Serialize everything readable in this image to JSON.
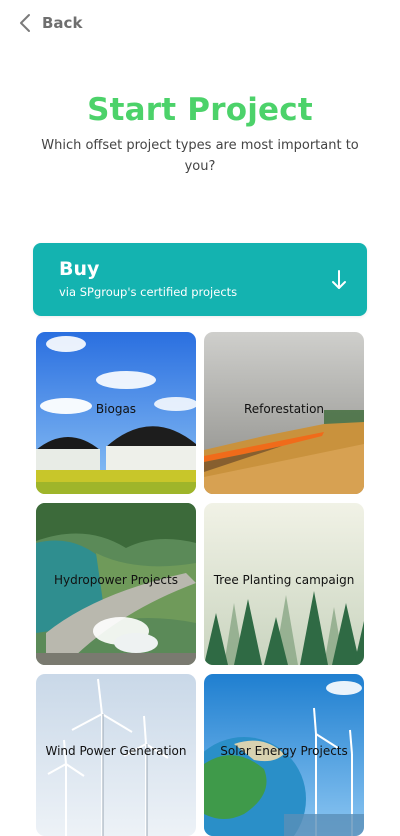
{
  "header": {
    "back_label": "Back"
  },
  "intro": {
    "title": "Start Project",
    "subtitle": "Which offset project types are most important to you?"
  },
  "buy": {
    "label": "Buy",
    "sub": "via SPgroup's certified projects"
  },
  "projects": [
    {
      "label": "Biogas"
    },
    {
      "label": "Reforestation"
    },
    {
      "label": "Hydropower Projects"
    },
    {
      "label": "Tree Planting campaign"
    },
    {
      "label": "Wind Power Generation"
    },
    {
      "label": "Solar Energy Projects"
    }
  ],
  "colors": {
    "accent_green": "#4cd26a",
    "buy_teal": "#14b3b0"
  }
}
